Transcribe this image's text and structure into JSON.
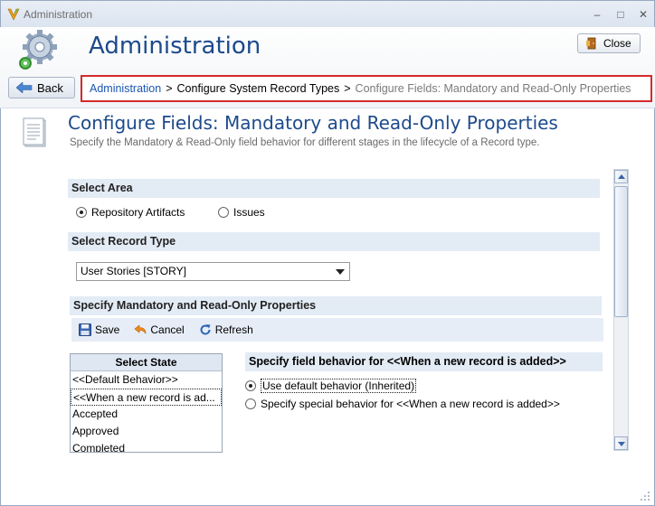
{
  "window": {
    "title": "Administration",
    "controls": [
      "–",
      "□",
      "✕"
    ]
  },
  "header": {
    "title": "Administration",
    "close_label": "Close"
  },
  "nav": {
    "back_label": "Back"
  },
  "breadcrumb": {
    "items": [
      "Administration",
      "Configure System Record Types",
      "Configure Fields: Mandatory and Read-Only Properties"
    ],
    "separator": ">"
  },
  "page": {
    "title": "Configure Fields: Mandatory and Read-Only Properties",
    "description": "Specify the Mandatory & Read-Only field behavior for different stages in the lifecycle of a Record type."
  },
  "area": {
    "heading": "Select Area",
    "options": [
      {
        "label": "Repository Artifacts",
        "checked": true
      },
      {
        "label": "Issues",
        "checked": false
      }
    ]
  },
  "record_type": {
    "heading": "Select Record Type",
    "selected": "User Stories [STORY]"
  },
  "properties": {
    "heading": "Specify Mandatory and Read-Only Properties",
    "toolbar": {
      "save": "Save",
      "cancel": "Cancel",
      "refresh": "Refresh"
    }
  },
  "states": {
    "header": "Select State",
    "items": [
      "<<Default Behavior>>",
      "<<When a new record is ad...",
      "Accepted",
      "Approved",
      "Completed"
    ],
    "selected_index": 1
  },
  "behavior": {
    "heading": "Specify field behavior for <<When a new record is added>>",
    "options": [
      {
        "label": "Use default behavior (Inherited)",
        "checked": true
      },
      {
        "label": "Specify special behavior for <<When a new record is added>>",
        "checked": false
      }
    ]
  },
  "colors": {
    "accent": "#1d4a8c",
    "link": "#1a56b0",
    "highlight_border": "#d42a2a",
    "section_bg": "#e3ebf5"
  }
}
